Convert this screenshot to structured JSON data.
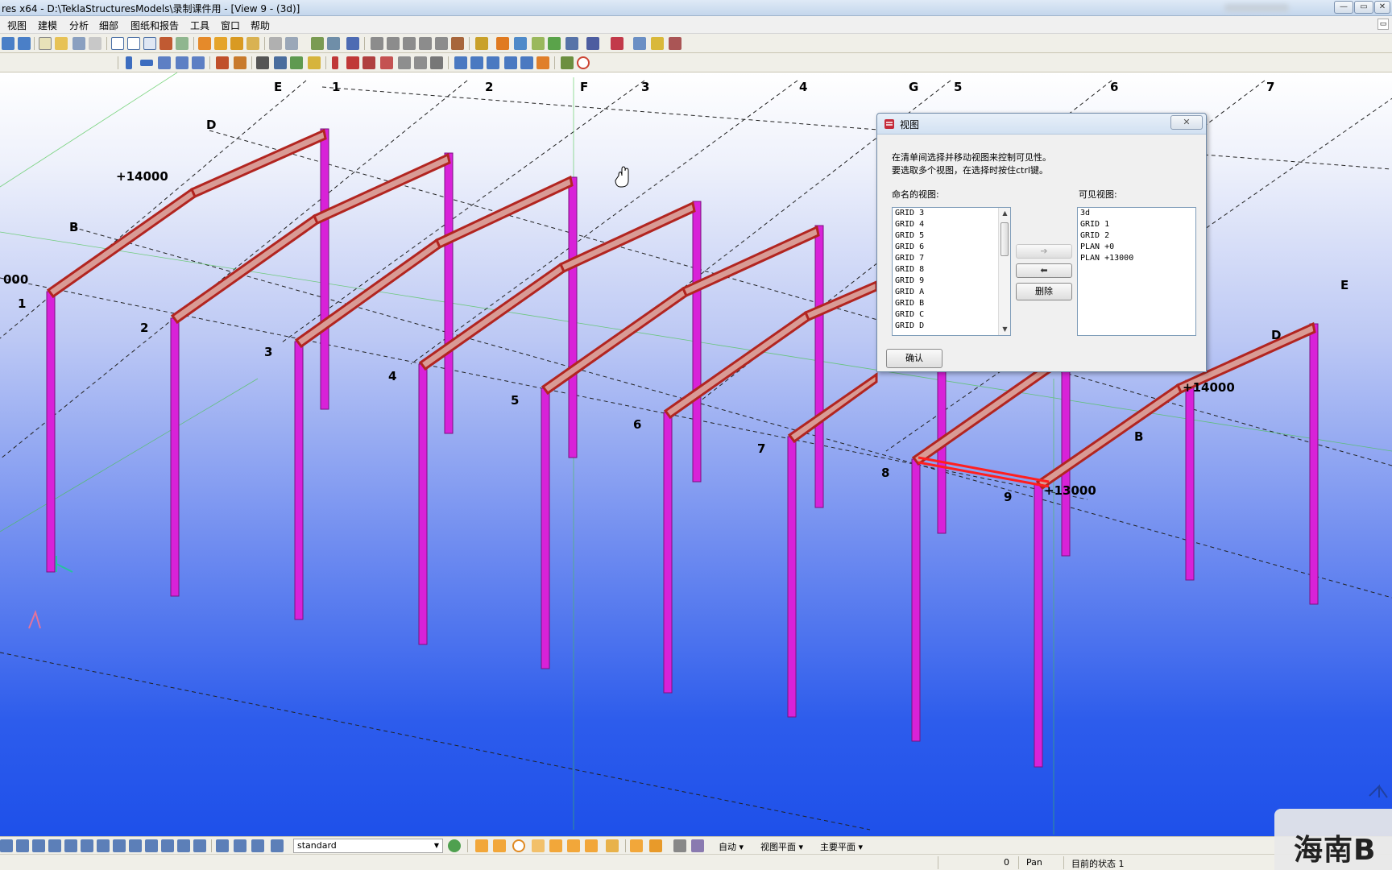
{
  "window": {
    "title": "res x64 - D:\\TeklaStructuresModels\\录制课件用 - [View 9 - (3d)]"
  },
  "menu": {
    "items": [
      "视图",
      "建模",
      "分析",
      "细部",
      "图纸和报告",
      "工具",
      "窗口",
      "帮助"
    ]
  },
  "viewport": {
    "grid_labels_top": [
      "E",
      "1",
      "2",
      "F",
      "3",
      "4",
      "G",
      "5",
      "6",
      "7"
    ],
    "grid_labels_left": [
      "D",
      "B",
      "1",
      "2",
      "3",
      "4",
      "5",
      "6",
      "7",
      "8",
      "9"
    ],
    "grid_labels_right": [
      "E",
      "D",
      "B"
    ],
    "level_labels": [
      "+14000",
      "000",
      "+14000",
      "+13000"
    ]
  },
  "dialog": {
    "title": "视图",
    "close_label": "✕",
    "instruction_line1": "在清单间选择并移动视图来控制可见性。",
    "instruction_line2": "要选取多个视图，在选择时按住ctrl键。",
    "named_views_label": "命名的视图:",
    "visible_views_label": "可见视图:",
    "named_views": [
      "GRID 3",
      "GRID 4",
      "GRID 5",
      "GRID 6",
      "GRID 7",
      "GRID 8",
      "GRID 9",
      "GRID A",
      "GRID B",
      "GRID C",
      "GRID D"
    ],
    "visible_views": [
      "3d",
      "GRID 1",
      "GRID 2",
      "PLAN +0",
      "PLAN +13000"
    ],
    "move_right_label": "➔",
    "move_left_label": "⬅",
    "delete_label": "删除",
    "ok_label": "确认"
  },
  "bottom_toolbar": {
    "filter_value": "standard",
    "snap_mode": "自动",
    "plane_mode": "视图平面",
    "main_plane": "主要平面"
  },
  "status": {
    "count": "0",
    "command": "Pan",
    "state": "目前的状态 1"
  },
  "watermark": {
    "text": "海南B"
  },
  "colors": {
    "column": "#d21fd6",
    "rafter": "#c4352f",
    "rafter_fill": "#d89690",
    "selected_beam": "#ff2222"
  }
}
